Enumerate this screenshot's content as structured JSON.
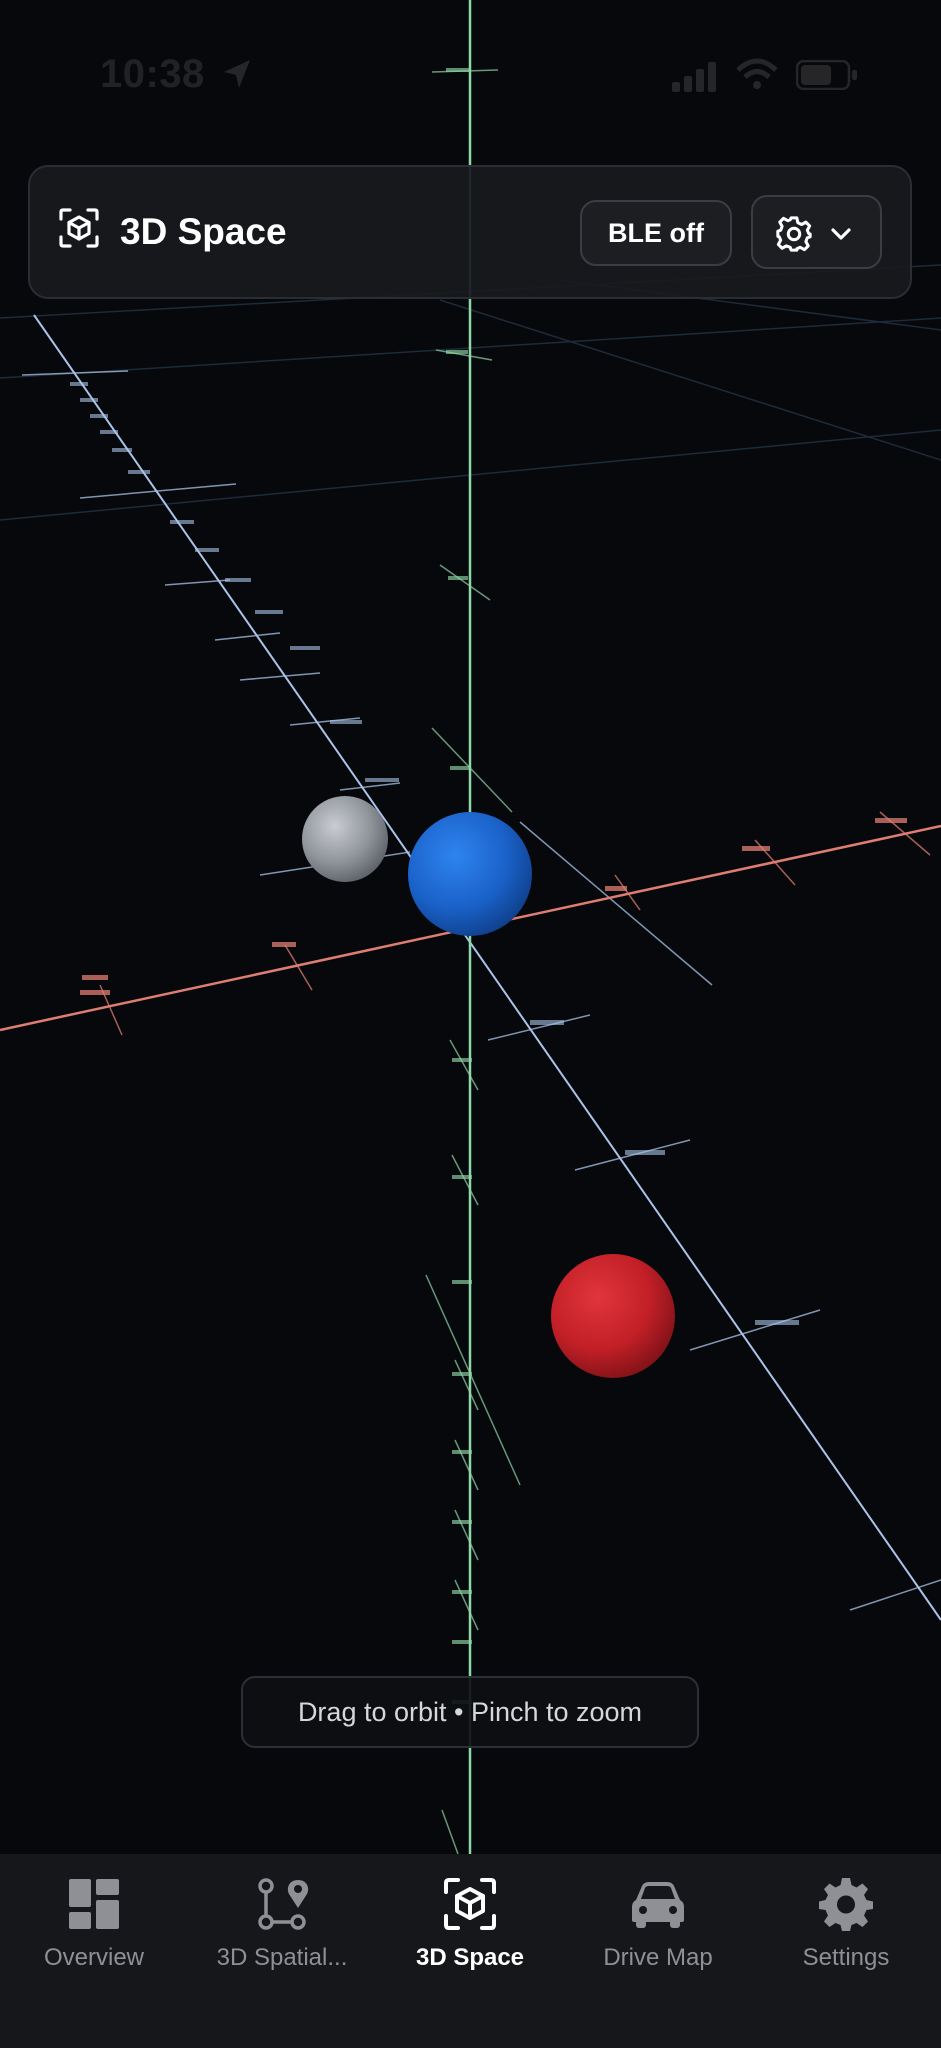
{
  "status_bar": {
    "time": "10:38"
  },
  "header": {
    "title": "3D Space",
    "title_icon": "cube-scan-icon",
    "ble_label": "BLE off",
    "settings_icon": "gear-icon",
    "dropdown_icon": "chevron-down-icon"
  },
  "scene": {
    "background_color": "#07080b",
    "axis_colors": {
      "x": "#e07d72",
      "y": "#8fd6a8",
      "z": "#a9c4e8"
    },
    "spheres": [
      {
        "name": "gray",
        "color": "#9aa0a8"
      },
      {
        "name": "blue",
        "color": "#1e6fd9"
      },
      {
        "name": "red",
        "color": "#d0232b"
      }
    ]
  },
  "hint": {
    "text": "Drag to orbit • Pinch to zoom"
  },
  "tabs": [
    {
      "label": "Overview",
      "icon": "dashboard-icon",
      "active": false
    },
    {
      "label": "3D Spatial...",
      "icon": "spatial-nodes-icon",
      "active": false
    },
    {
      "label": "3D Space",
      "icon": "cube-scan-icon",
      "active": true
    },
    {
      "label": "Drive Map",
      "icon": "car-icon",
      "active": false
    },
    {
      "label": "Settings",
      "icon": "gear-icon",
      "active": false
    }
  ],
  "colors": {
    "tab_bar_bg": "#16171a",
    "tab_inactive": "#8e9095",
    "tab_active": "#ffffff",
    "card_bg": "#181a1e"
  }
}
